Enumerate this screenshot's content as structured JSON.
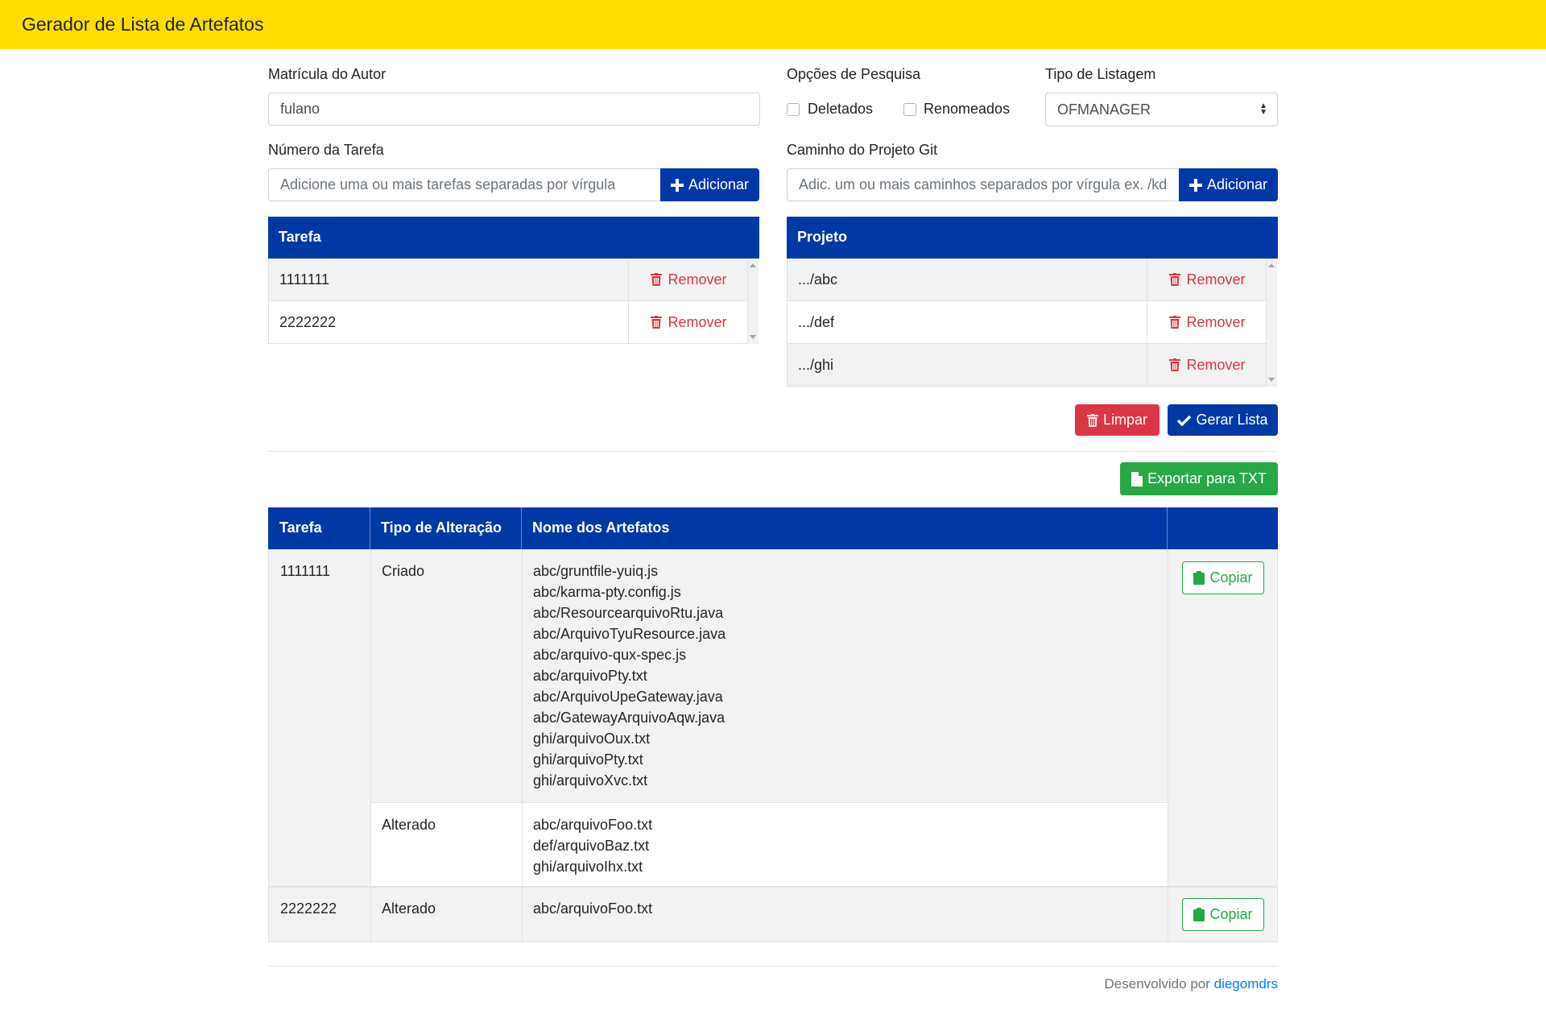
{
  "app": {
    "title": "Gerador de Lista de Artefatos"
  },
  "form": {
    "author_label": "Matrícula do Autor",
    "author_value": "fulano",
    "search_options_label": "Opções de Pesquisa",
    "deleted_label": "Deletados",
    "renamed_label": "Renomeados",
    "list_type_label": "Tipo de Listagem",
    "list_type_value": "OFMANAGER",
    "task_label": "Número da Tarefa",
    "task_placeholder": "Adicione uma ou mais tarefas separadas por vírgula",
    "project_label": "Caminho do Projeto Git",
    "project_placeholder": "Adic. um ou mais caminhos separados por vírgula ex. /kdi/git/projeto",
    "add_label": "Adicionar"
  },
  "tasks_table": {
    "header": "Tarefa",
    "remove_label": "Remover",
    "rows": [
      "1111111",
      "2222222"
    ]
  },
  "projects_table": {
    "header": "Projeto",
    "remove_label": "Remover",
    "rows": [
      ".../abc",
      ".../def",
      ".../ghi"
    ]
  },
  "actions": {
    "clear_label": "Limpar",
    "generate_label": "Gerar Lista",
    "export_label": "Exportar para TXT"
  },
  "results": {
    "headers": [
      "Tarefa",
      "Tipo de Alteração",
      "Nome dos Artefatos",
      ""
    ],
    "copy_label": "Copiar",
    "groups": [
      {
        "task": "1111111",
        "changes": [
          {
            "type": "Criado",
            "files": [
              "abc/gruntfile-yuiq.js",
              "abc/karma-pty.config.js",
              "abc/ResourcearquivoRtu.java",
              "abc/ArquivoTyuResource.java",
              "abc/arquivo-qux-spec.js",
              "abc/arquivoPty.txt",
              "abc/ArquivoUpeGateway.java",
              "abc/GatewayArquivoAqw.java",
              "ghi/arquivoOux.txt",
              "ghi/arquivoPty.txt",
              "ghi/arquivoXvc.txt"
            ]
          },
          {
            "type": "Alterado",
            "files": [
              "abc/arquivoFoo.txt",
              "def/arquivoBaz.txt",
              "ghi/arquivoIhx.txt"
            ]
          }
        ]
      },
      {
        "task": "2222222",
        "changes": [
          {
            "type": "Alterado",
            "files": [
              "abc/arquivoFoo.txt"
            ]
          }
        ]
      }
    ]
  },
  "footer": {
    "developed_by": "Desenvolvido por",
    "author_link": "diegomdrs"
  },
  "colors": {
    "navbar": "#ffdd00",
    "primary": "#0039a6",
    "danger": "#dc3545",
    "success": "#28a745"
  },
  "icons": {
    "trash": "trash-icon",
    "plus": "plus-icon",
    "check": "check-icon",
    "file": "file-icon",
    "clipboard": "clipboard-icon",
    "caret": "sort-caret-icon"
  }
}
